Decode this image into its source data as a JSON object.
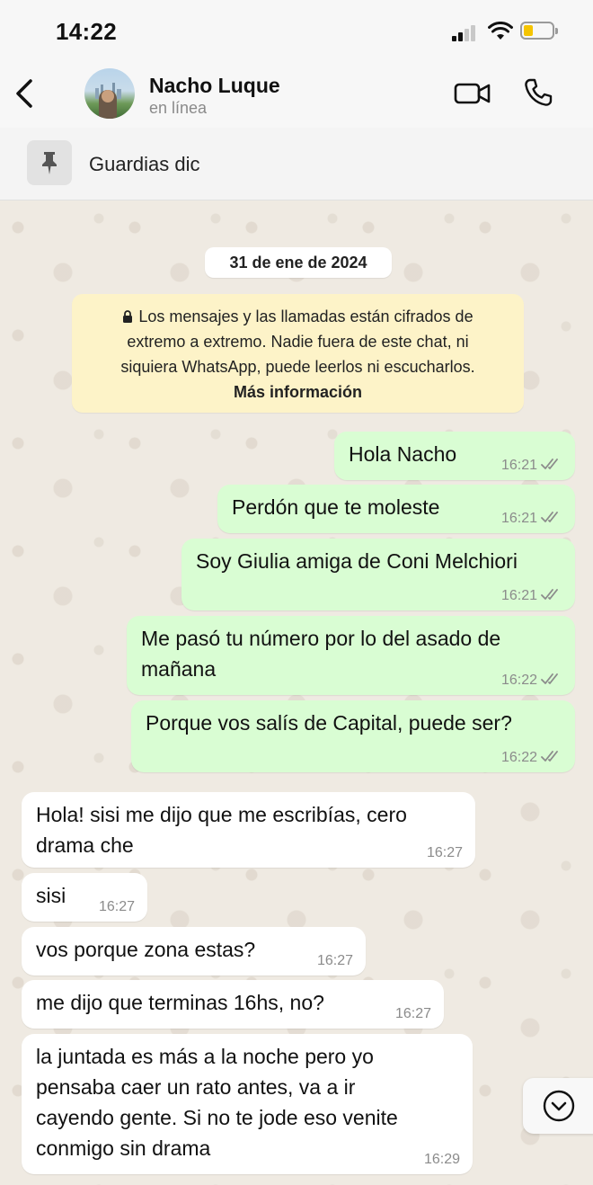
{
  "status_bar": {
    "time": "14:22"
  },
  "header": {
    "contact_name": "Nacho Luque",
    "presence": "en línea"
  },
  "pinned": {
    "text": "Guardias dic"
  },
  "chat": {
    "date": "31 de ene de 2024",
    "encryption_notice": {
      "line1": "Los mensajes y las llamadas están cifrados de",
      "line2": "extremo a extremo. Nadie fuera de este chat, ni",
      "line3": "siquiera WhatsApp, puede leerlos ni escucharlos.",
      "link": "Más información"
    },
    "messages": [
      {
        "direction": "out",
        "lines": [
          "Hola Nacho"
        ],
        "time": "16:21",
        "status": "read"
      },
      {
        "direction": "out",
        "lines": [
          "Perdón que te moleste"
        ],
        "time": "16:21",
        "status": "read"
      },
      {
        "direction": "out",
        "lines": [
          "Soy Giulia amiga de Coni Melchiori"
        ],
        "time": "16:21",
        "status": "read"
      },
      {
        "direction": "out",
        "lines": [
          "Me pasó tu número por lo del asado de",
          "mañana"
        ],
        "time": "16:22",
        "status": "read"
      },
      {
        "direction": "out",
        "lines": [
          "Porque vos salís de Capital, puede ser?"
        ],
        "time": "16:22",
        "status": "read"
      },
      {
        "direction": "in",
        "lines": [
          "Hola! sisi me dijo que me escribías, cero",
          "drama che"
        ],
        "time": "16:27"
      },
      {
        "direction": "in",
        "lines": [
          "sisi"
        ],
        "time": "16:27"
      },
      {
        "direction": "in",
        "lines": [
          "vos porque zona estas?"
        ],
        "time": "16:27"
      },
      {
        "direction": "in",
        "lines": [
          "me dijo que terminas 16hs, no?"
        ],
        "time": "16:27"
      },
      {
        "direction": "in",
        "lines": [
          "la juntada es más a la noche pero yo",
          "pensaba caer un rato antes,  va a ir",
          "cayendo gente. Si no te jode eso venite",
          "conmigo sin drama"
        ],
        "time": "16:29"
      }
    ]
  },
  "icons": {
    "back": "chevron-left-icon",
    "video": "video-camera-icon",
    "call": "phone-icon",
    "pin": "pin-icon",
    "scroll": "chevron-down-circle-icon",
    "read_status": "double-check-icon"
  },
  "colors": {
    "outgoing_bubble": "#d9fdd3",
    "incoming_bubble": "#ffffff",
    "encryption_notice_bg": "#fdf3c8",
    "chat_background": "#efeae2",
    "battery_fill": "#f5c400"
  }
}
